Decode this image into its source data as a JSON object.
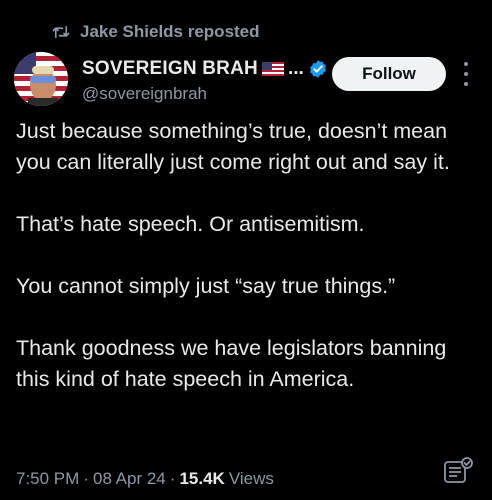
{
  "repost": {
    "label": "Jake Shields reposted"
  },
  "author": {
    "display_name": "SOVEREIGN BRAH",
    "name_truncation": "...",
    "handle": "@sovereignbrah",
    "verified": true,
    "verified_color": "#1d9bf0"
  },
  "follow_button": {
    "label": "Follow"
  },
  "tweet": {
    "paragraphs": [
      "Just because something’s true, doesn’t mean you can literally just come right out and say it.",
      "That’s hate speech. Or antisemitism.",
      "You cannot simply just “say true things.”",
      "Thank goodness we have legislators banning this kind of hate speech in America."
    ]
  },
  "meta": {
    "time": "7:50 PM",
    "date": "08 Apr 24",
    "views_count": "15.4K",
    "views_label": "Views",
    "separator": "·"
  },
  "icons": {
    "repost": "repost-icon",
    "verified": "verified-badge-icon",
    "more": "more-options-icon",
    "analytics": "post-analytics-icon",
    "flag": "us-flag-emoji"
  },
  "colors": {
    "background": "#000000",
    "text_primary": "#e7e9ea",
    "text_secondary": "#8b98a5",
    "follow_bg": "#eff3f4"
  }
}
